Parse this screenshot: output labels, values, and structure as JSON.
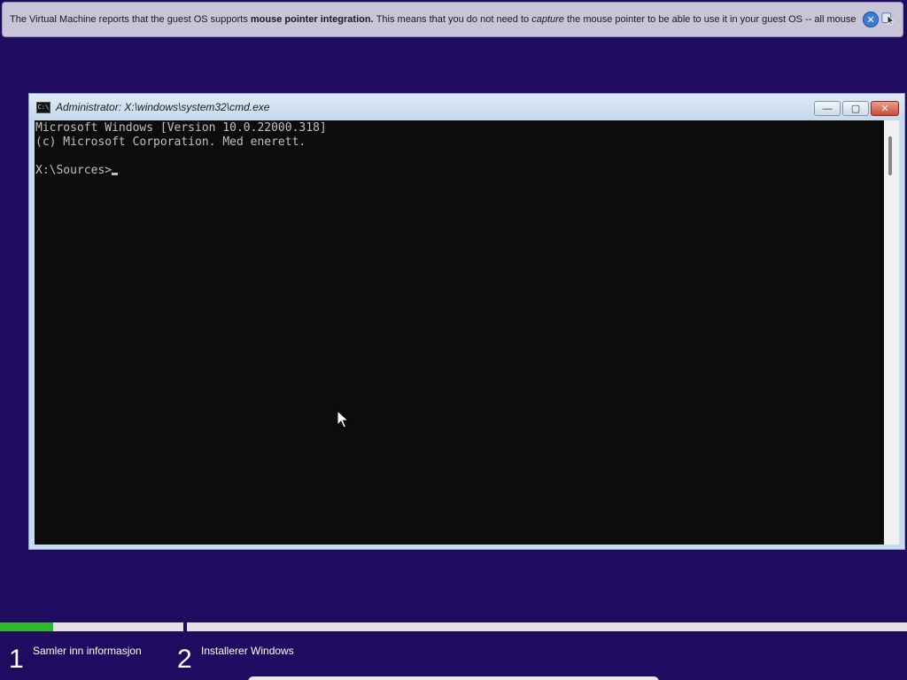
{
  "notification": {
    "part1": "The Virtual Machine reports that the guest OS supports ",
    "bold": "mouse pointer integration.",
    "part2": " This means that you do not need to ",
    "italic": "capture",
    "part3": " the mouse pointer to be able to use it in your guest OS -- all mouse"
  },
  "cmd_window": {
    "title": "Administrator: X:\\windows\\system32\\cmd.exe",
    "icon_text": "C:\\",
    "controls": {
      "minimize": "—",
      "maximize": "▢",
      "close": "✕"
    },
    "console_lines": [
      "Microsoft Windows [Version 10.0.22000.318]",
      "(c) Microsoft Corporation. Med enerett.",
      "",
      "X:\\Sources>"
    ]
  },
  "setup_progress": {
    "step1": {
      "number": "1",
      "label": "Samler inn informasjon"
    },
    "step2": {
      "number": "2",
      "label": "Installerer Windows"
    },
    "step1_fraction_complete": 0.29
  },
  "colors": {
    "background": "#1f0b5f",
    "progress_fill": "#2eb82e",
    "console_bg": "#0c0c0c",
    "console_fg": "#c0c0c0"
  },
  "icons": {
    "banner_close": "close-icon",
    "banner_mouse": "mouse-integration-icon",
    "cmd_app": "cmd-app-icon",
    "pointer": "mouse-pointer-icon"
  }
}
